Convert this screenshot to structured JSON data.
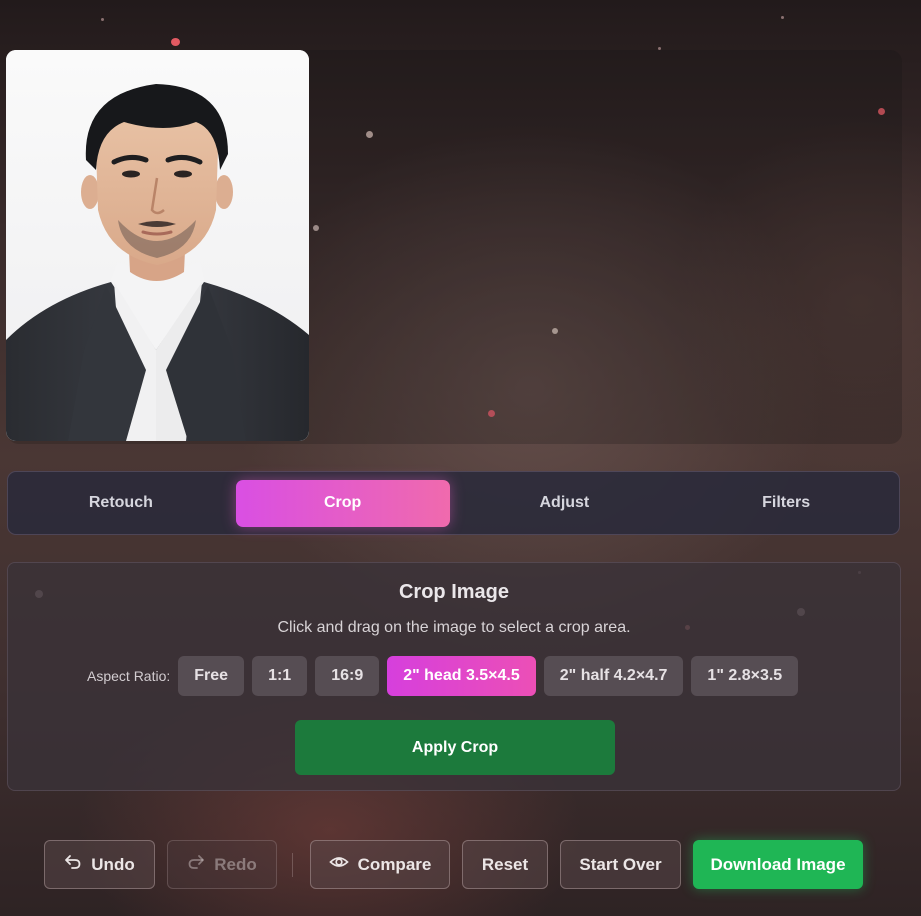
{
  "tabs": [
    {
      "label": "Retouch",
      "active": false
    },
    {
      "label": "Crop",
      "active": true
    },
    {
      "label": "Adjust",
      "active": false
    },
    {
      "label": "Filters",
      "active": false
    }
  ],
  "crop": {
    "title": "Crop Image",
    "hint": "Click and drag on the image to select a crop area.",
    "aspect_label": "Aspect Ratio:",
    "ratios": [
      "Free",
      "1:1",
      "16:9",
      "2\" head 3.5×4.5",
      "2\" half 4.2×4.7",
      "1\" 2.8×3.5"
    ],
    "selected_ratio": "2\" head 3.5×4.5",
    "apply_label": "Apply Crop"
  },
  "toolbar": {
    "undo": "Undo",
    "redo": "Redo",
    "compare": "Compare",
    "reset": "Reset",
    "start_over": "Start Over",
    "download": "Download Image"
  },
  "colors": {
    "accent_gradient_start": "#d94fe3",
    "accent_gradient_end": "#f06aad",
    "apply_green": "#1c7a3c",
    "download_green": "#1fb655"
  }
}
